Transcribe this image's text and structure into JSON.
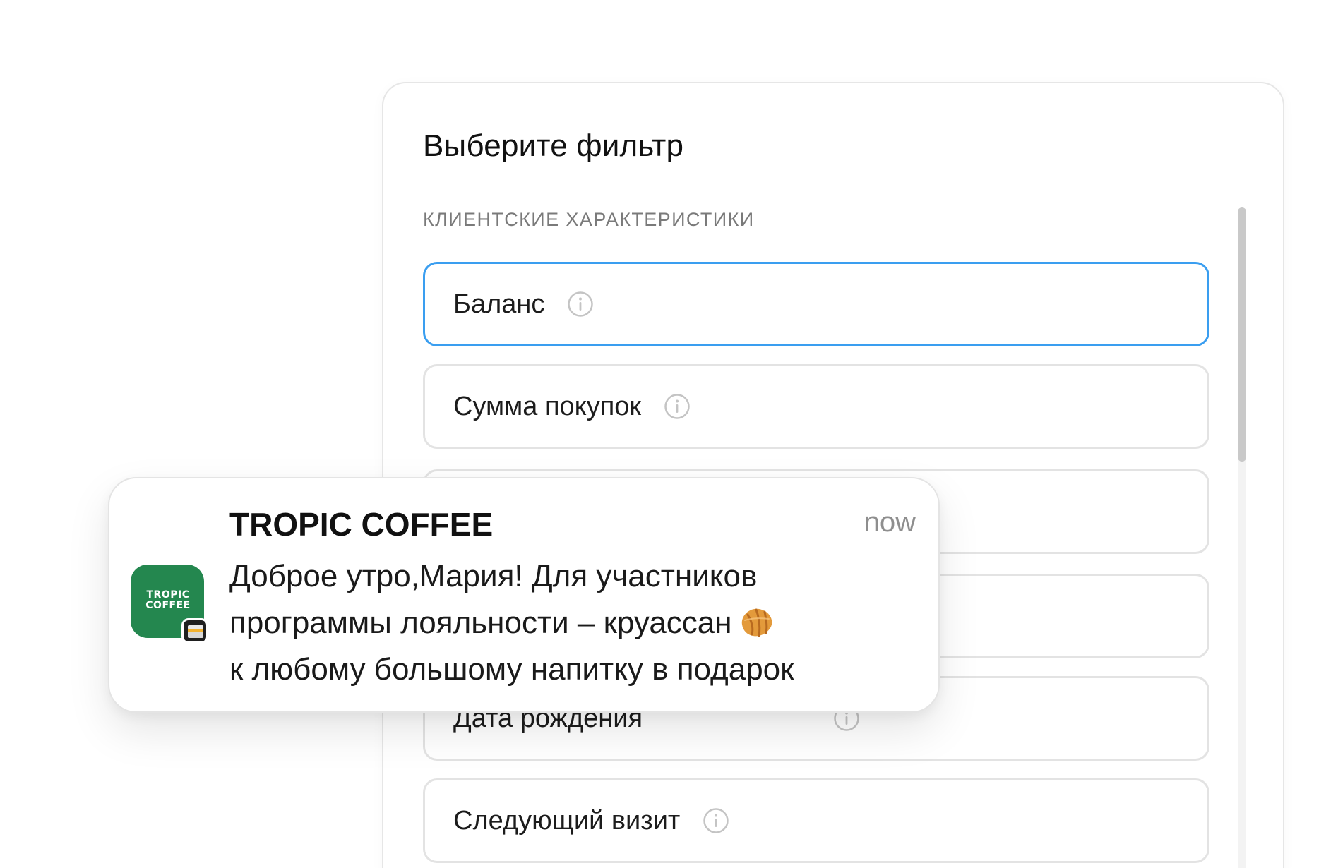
{
  "panel": {
    "title": "Выберите фильтр",
    "section_label": "КЛИЕНТСКИЕ ХАРАКТЕРИСТИКИ",
    "items": [
      {
        "label": "Баланс",
        "selected": true,
        "icon": "info-icon"
      },
      {
        "label": "Сумма покупок",
        "selected": false,
        "icon": "info-icon"
      },
      {
        "label": "",
        "selected": false,
        "icon": "info-icon"
      },
      {
        "label": "",
        "selected": false,
        "icon": "info-icon"
      },
      {
        "label": "Дата рождения",
        "selected": false,
        "icon": "info-icon"
      },
      {
        "label": "Следующий визит",
        "selected": false,
        "icon": "info-icon"
      }
    ]
  },
  "notification": {
    "app_name": "TROPIC COFFEE",
    "app_icon_text": [
      "TROPIC",
      "COFFEE"
    ],
    "time": "now",
    "body_lines": [
      "Доброе утро,Мария! Для участников",
      "программы лояльности – круассан",
      "к любому большому напитку в подарок"
    ],
    "emoji": "croissant-icon"
  },
  "colors": {
    "selected_border": "#3a9ef0",
    "app_icon_bg": "#24874f",
    "item_border": "#e3e3e3"
  }
}
